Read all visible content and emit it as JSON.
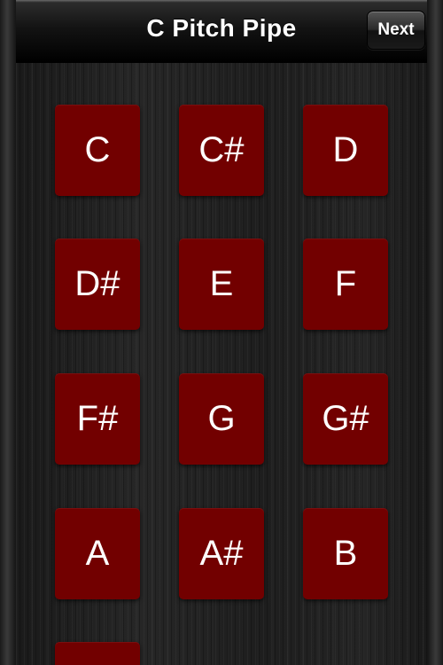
{
  "navbar": {
    "title": "C Pitch Pipe",
    "next_label": "Next"
  },
  "notes": [
    "C",
    "C#",
    "D",
    "D#",
    "E",
    "F",
    "F#",
    "G",
    "G#",
    "A",
    "A#",
    "B"
  ],
  "partial_key_label": "",
  "colors": {
    "key_background": "#720000",
    "key_text": "#ffffff",
    "wood_background": "#1c1c1c"
  }
}
